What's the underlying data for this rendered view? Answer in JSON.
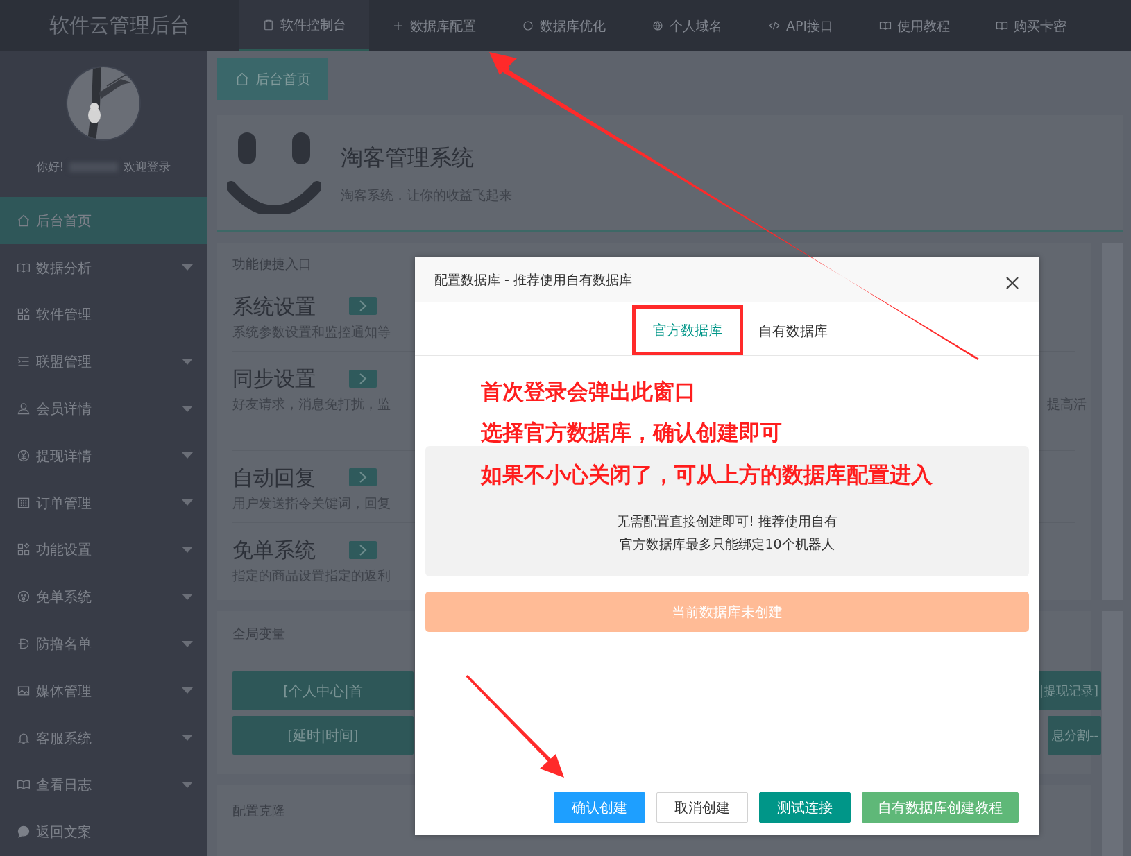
{
  "top_nav": {
    "logo": "软件云管理后台",
    "items": [
      {
        "label": "软件控制台",
        "selected": true
      },
      {
        "label": "数据库配置",
        "selected": false
      },
      {
        "label": "数据库优化",
        "selected": false
      },
      {
        "label": "个人域名",
        "selected": false
      },
      {
        "label": "API接口",
        "selected": false
      },
      {
        "label": "使用教程",
        "selected": false
      },
      {
        "label": "购买卡密",
        "selected": false
      }
    ]
  },
  "sidebar": {
    "greeting": "你好!",
    "welcome": "欢迎登录",
    "items": [
      {
        "label": "后台首页",
        "selected": true,
        "expandable": false
      },
      {
        "label": "数据分析",
        "selected": false,
        "expandable": true
      },
      {
        "label": "软件管理",
        "selected": false,
        "expandable": false
      },
      {
        "label": "联盟管理",
        "selected": false,
        "expandable": true
      },
      {
        "label": "会员详情",
        "selected": false,
        "expandable": true
      },
      {
        "label": "提现详情",
        "selected": false,
        "expandable": true
      },
      {
        "label": "订单管理",
        "selected": false,
        "expandable": true
      },
      {
        "label": "功能设置",
        "selected": false,
        "expandable": true
      },
      {
        "label": "免单系统",
        "selected": false,
        "expandable": true
      },
      {
        "label": "防撸名单",
        "selected": false,
        "expandable": true
      },
      {
        "label": "媒体管理",
        "selected": false,
        "expandable": true
      },
      {
        "label": "客服系统",
        "selected": false,
        "expandable": true
      },
      {
        "label": "查看日志",
        "selected": false,
        "expandable": true
      },
      {
        "label": "返回文案",
        "selected": false,
        "expandable": false
      }
    ]
  },
  "breadcrumb": "后台首页",
  "banner": {
    "title": "淘客管理系统",
    "subtitle": "淘客系统．让你的收益飞起来"
  },
  "shortcuts": {
    "title": "功能便捷入口",
    "items": [
      {
        "title": "系统设置",
        "description": "系统参数设置和监控通知等"
      },
      {
        "title": "同步设置",
        "description": "好友请求，消息免打扰，监",
        "description_right": "提高活"
      },
      {
        "title": "自动回复",
        "description": "用户发送指令关键词，回复"
      },
      {
        "title": "免单系统",
        "description": "指定的商品设置指定的返利"
      }
    ]
  },
  "variables": {
    "title": "全局变量",
    "rows": [
      {
        "left": "[个人中心|首",
        "right": "|提现记录]"
      },
      {
        "left": "[延时|时间]",
        "right": "息分割--"
      }
    ]
  },
  "clone": {
    "title": "配置克隆"
  },
  "modal": {
    "title": "配置数据库 - 推荐使用自有数据库",
    "tabs": [
      {
        "label": "官方数据库",
        "selected": true
      },
      {
        "label": "自有数据库",
        "selected": false
      }
    ],
    "notice": [
      "无需配置直接创建即可! 推荐使用自有",
      "官方数据库最多只能绑定10个机器人"
    ],
    "status": "当前数据库未创建",
    "buttons": [
      {
        "label": "确认创建",
        "kind": "primary"
      },
      {
        "label": "取消创建",
        "kind": "plain"
      },
      {
        "label": "测试连接",
        "kind": "teal"
      },
      {
        "label": "自有数据库创建教程",
        "kind": "green"
      }
    ]
  },
  "annotations": [
    "首次登录会弹出此窗口",
    "选择官方数据库，确认创建即可",
    "如果不小心关闭了，可从上方的数据库配置进入"
  ]
}
